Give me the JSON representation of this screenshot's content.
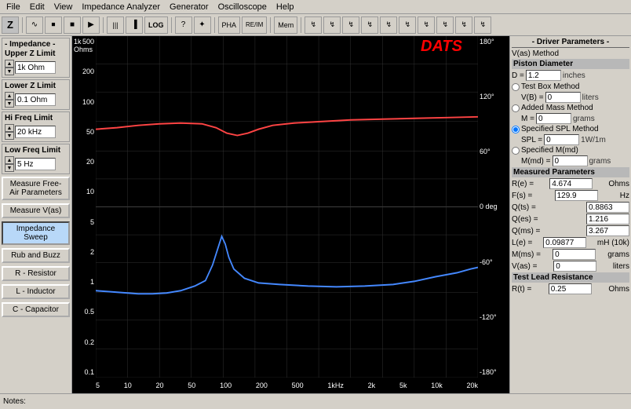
{
  "menubar": {
    "items": [
      "File",
      "Edit",
      "View",
      "Impedance Analyzer",
      "Generator",
      "Oscilloscope",
      "Help"
    ]
  },
  "toolbar": {
    "z_btn": "Z",
    "buttons": [
      "~",
      "⏏",
      "⏏",
      "▶▶",
      "|||",
      "▐",
      "LOG",
      "?",
      "✦",
      "PHA",
      "RE/IM",
      "Mem"
    ]
  },
  "left_panel": {
    "impedance_label": "- Impedance -",
    "upper_z_label": "Upper Z Limit",
    "upper_z_value": "1k Ohm",
    "lower_z_label": "Lower Z Limit",
    "lower_z_value": "0.1 Ohm",
    "hi_freq_label": "Hi Freq Limit",
    "hi_freq_value": "20 kHz",
    "low_freq_label": "Low Freq Limit",
    "low_freq_value": "5 Hz",
    "measure_free_air": "Measure Free-Air Parameters",
    "measure_vas": "Measure V(as)",
    "impedance_sweep": "Impedance Sweep",
    "rub_buzz": "Rub and Buzz",
    "r_resistor": "R - Resistor",
    "l_inductor": "L - Inductor",
    "c_capacitor": "C - Capacitor"
  },
  "chart": {
    "title": "DATS",
    "ohms_label": "1k\nOhms",
    "deg_label": "180°",
    "y_left": [
      "500",
      "200",
      "100",
      "50",
      "20",
      "10",
      "5",
      "2",
      "1",
      "0.5",
      "0.2",
      "0.1"
    ],
    "y_right": [
      "180°",
      "120°",
      "60°",
      "0 deg",
      "-60°",
      "-120°",
      "-180°"
    ],
    "x_axis": [
      "5",
      "10",
      "20",
      "50",
      "100",
      "200",
      "500",
      "1kHz",
      "2k",
      "5k",
      "10k",
      "20k"
    ]
  },
  "right_panel": {
    "title": "- Driver Parameters -",
    "vas_method_label": "V(as) Method",
    "piston_diameter_label": "Piston Diameter",
    "d_label": "D =",
    "d_value": "1.2",
    "d_unit": "inches",
    "test_box_label": "Test Box Method",
    "vb_label": "V(B) =",
    "vb_value": "0",
    "vb_unit": "liters",
    "added_mass_label": "Added Mass Method",
    "m_label": "M =",
    "m_value": "0",
    "m_unit": "grams",
    "specified_spl_label": "Specified SPL Method",
    "spl_label": "SPL =",
    "spl_value": "0",
    "spl_unit": "1W/1m",
    "specified_mmd_label": "Specified M(md)",
    "mmd_label": "M(md) =",
    "mmd_value": "0",
    "mmd_unit": "grams",
    "measured_params_label": "Measured Parameters",
    "re_label": "R(e) =",
    "re_value": "4.674",
    "re_unit": "Ohms",
    "fs_label": "F(s) =",
    "fs_value": "129.9",
    "fs_unit": "Hz",
    "qts_label": "Q(ts) =",
    "qts_value": "0.8863",
    "qes_label": "Q(es) =",
    "qes_value": "1.216",
    "qms_label": "Q(ms) =",
    "qms_value": "3.267",
    "le_label": "L(e) =",
    "le_value": "0.09877",
    "le_unit": "mH (10k)",
    "mms_label": "M(ms) =",
    "mms_value": "0",
    "mms_unit": "grams",
    "vas_label": "V(as) =",
    "vas_value": "0",
    "vas_unit": "liters",
    "test_lead_label": "Test Lead Resistance",
    "rt_label": "R(t) =",
    "rt_value": "0.25",
    "rt_unit": "Ohms"
  },
  "statusbar": {
    "notes_label": "Notes:"
  }
}
